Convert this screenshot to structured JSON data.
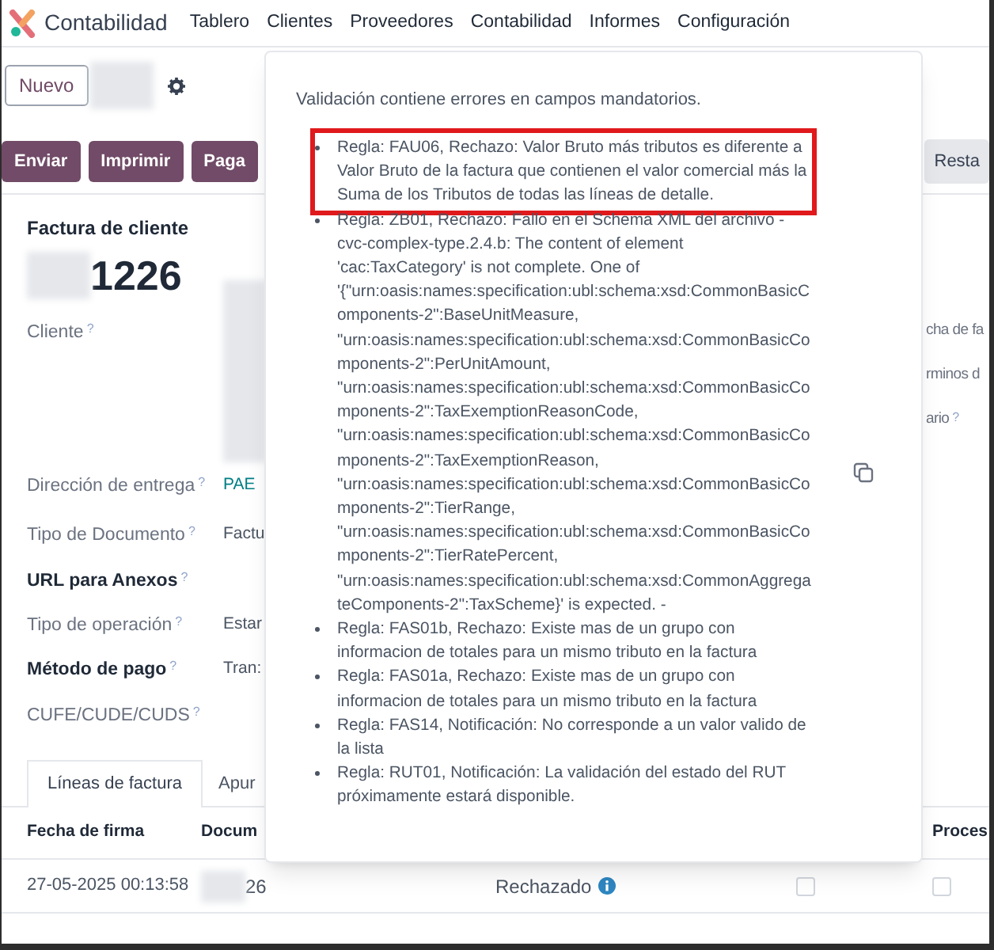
{
  "app": {
    "name": "Contabilidad"
  },
  "menu": [
    "Tablero",
    "Clientes",
    "Proveedores",
    "Contabilidad",
    "Informes",
    "Configuración"
  ],
  "control_panel": {
    "new_button": "Nuevo"
  },
  "actions": [
    {
      "label": "Enviar",
      "kind": "primary"
    },
    {
      "label": "Imprimir",
      "kind": "primary"
    },
    {
      "label": "Paga",
      "kind": "primary"
    },
    {
      "label": "Resta",
      "kind": "secondary"
    }
  ],
  "form": {
    "title": "Factura de cliente",
    "number": "1226",
    "fields": [
      {
        "label": "Cliente",
        "help": "?",
        "required": false
      },
      {
        "label": "Dirección de entrega",
        "help": "?",
        "required": false,
        "value": {
          "text": "PAE",
          "kind": "link"
        }
      },
      {
        "label": "Tipo de Documento",
        "help": "?",
        "required": false,
        "value": {
          "text": "Factu",
          "kind": "text"
        }
      },
      {
        "label": "URL para Anexos",
        "help": "?",
        "required": true
      },
      {
        "label": "Tipo de operación",
        "help": "?",
        "required": false,
        "value": {
          "text": "Estar",
          "kind": "text"
        }
      },
      {
        "label": "Método de pago",
        "help": "?",
        "required": true,
        "value": {
          "text": "Tran:",
          "kind": "text"
        }
      },
      {
        "label": "CUFE/CUDE/CUDS",
        "help": "?",
        "required": false
      }
    ],
    "right_fields": [
      {
        "label": "cha de fa"
      },
      {
        "label": "rminos d"
      },
      {
        "label": "ario",
        "help": "?"
      }
    ]
  },
  "tabs": [
    {
      "label": "Líneas de factura",
      "selected": true
    },
    {
      "label": "Apur",
      "selected": false
    }
  ],
  "table": {
    "columns": [
      "Fecha de firma",
      "Docum",
      "",
      "",
      "Proces"
    ],
    "rows": [
      {
        "date": "27-05-2025 00:13:58",
        "document": "26",
        "status": "Rechazado",
        "checks": [
          false,
          false
        ]
      }
    ]
  },
  "popover": {
    "message": "Validación contiene errores en campos mandatorios.",
    "errors": [
      {
        "text": "Regla: FAU06, Rechazo: Valor Bruto más tributos es diferente a Valor Bruto de la factura que contienen el valor comercial más la Suma de los Tributos de todas las líneas de detalle.",
        "highlighted": true
      },
      {
        "text": "Regla: ZB01, Rechazo: Fallo en el Schema XML del archivo - cvc-complex-type.2.4.b: The content of element 'cac:TaxCategory' is not complete. One of '{\"urn:oasis:names:specification:ubl:schema:xsd:CommonBasicComponents-2\":BaseUnitMeasure, \"urn:oasis:names:specification:ubl:schema:xsd:CommonBasicComponents-2\":PerUnitAmount, \"urn:oasis:names:specification:ubl:schema:xsd:CommonBasicComponents-2\":TaxExemptionReasonCode, \"urn:oasis:names:specification:ubl:schema:xsd:CommonBasicComponents-2\":TaxExemptionReason, \"urn:oasis:names:specification:ubl:schema:xsd:CommonBasicComponents-2\":TierRange, \"urn:oasis:names:specification:ubl:schema:xsd:CommonBasicComponents-2\":TierRatePercent, \"urn:oasis:names:specification:ubl:schema:xsd:CommonAggregateComponents-2\":TaxScheme}' is expected. -",
        "highlighted": false
      },
      {
        "text": "Regla: FAS01b, Rechazo: Existe mas de un grupo con informacion de totales para un mismo tributo en la factura",
        "highlighted": false
      },
      {
        "text": "Regla: FAS01a, Rechazo: Existe mas de un grupo con informacion de totales para un mismo tributo en la factura",
        "highlighted": false
      },
      {
        "text": "Regla: FAS14, Notificación: No corresponde a un valor valido de la lista",
        "highlighted": false
      },
      {
        "text": "Regla: RUT01, Notificación: La validación del estado del RUT próximamente estará disponible.",
        "highlighted": false
      }
    ]
  }
}
